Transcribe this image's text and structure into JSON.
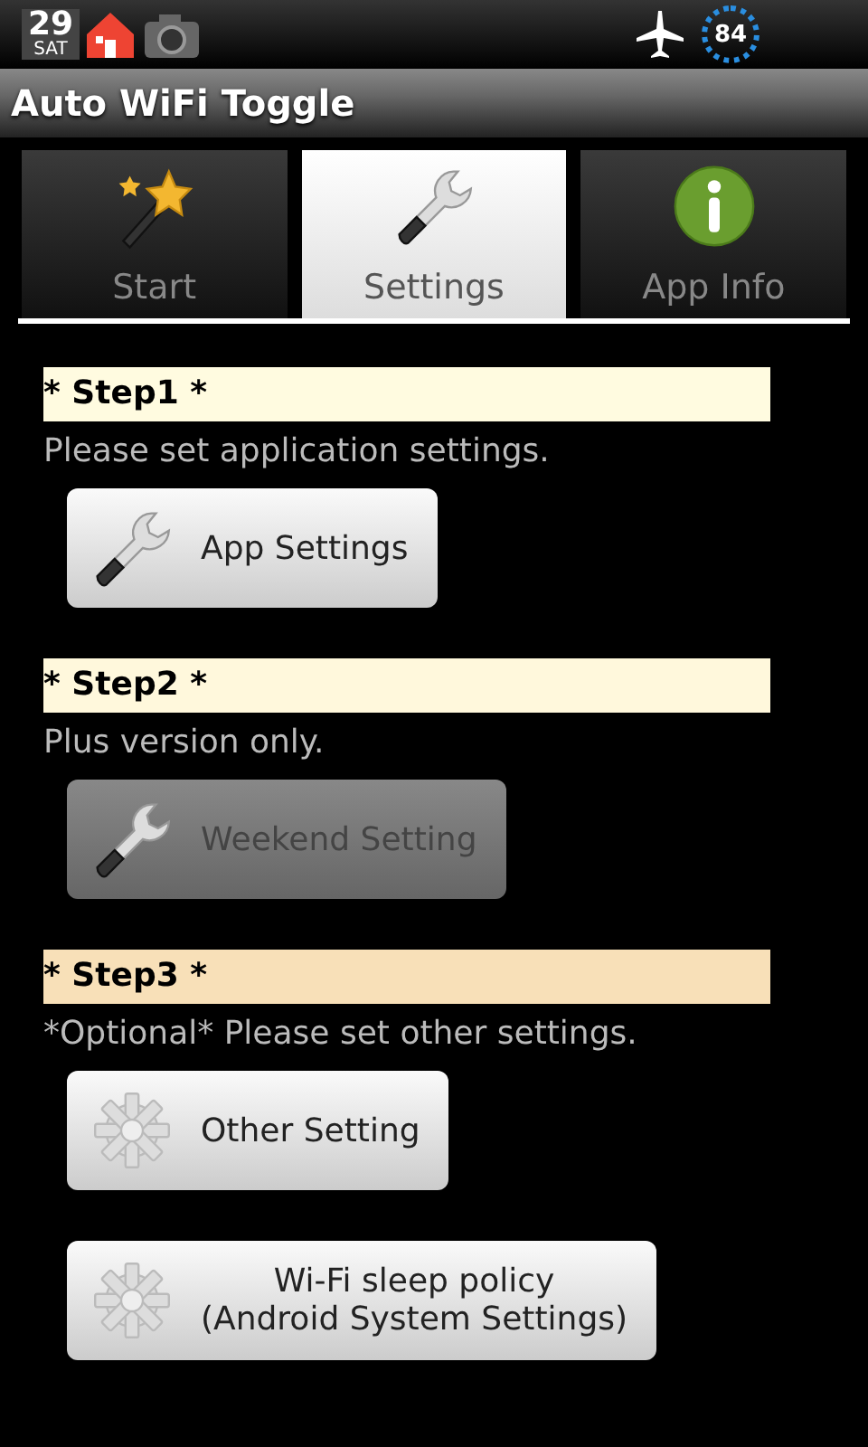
{
  "status_bar": {
    "date_day": "29",
    "date_weekday": "SAT",
    "battery": "84"
  },
  "window": {
    "title": "Auto WiFi Toggle"
  },
  "tabs": [
    {
      "label": "Start",
      "kind": "wand",
      "selected": false
    },
    {
      "label": "Settings",
      "kind": "wrench",
      "selected": true
    },
    {
      "label": "App Info",
      "kind": "info",
      "selected": false
    }
  ],
  "steps": [
    {
      "heading": "* Step1 *",
      "color": "#fffbe0",
      "description": "Please set application settings.",
      "buttons": [
        {
          "label": "App Settings",
          "kind": "wrench",
          "disabled": false
        }
      ]
    },
    {
      "heading": "* Step2 *",
      "color": "#fff8dc",
      "description": "Plus version only.",
      "buttons": [
        {
          "label": "Weekend Setting",
          "kind": "wrench",
          "disabled": true
        }
      ]
    },
    {
      "heading": "* Step3 *",
      "color": "#f8e0b8",
      "description": "*Optional* Please set other settings.",
      "buttons": [
        {
          "label": "Other Setting",
          "kind": "gear",
          "disabled": false
        },
        {
          "label": "Wi-Fi sleep policy\n(Android System Settings)",
          "kind": "gear",
          "disabled": false
        }
      ]
    }
  ]
}
